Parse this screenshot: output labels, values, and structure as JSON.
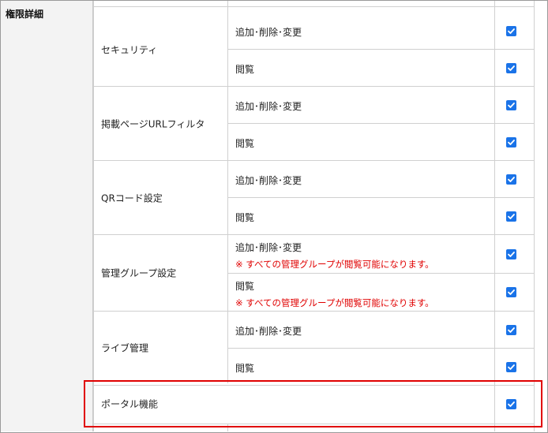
{
  "section": {
    "title": "権限詳細"
  },
  "categories": [
    {
      "name": "セキュリティ",
      "rows": [
        {
          "label": "追加･削除･変更",
          "note": ""
        },
        {
          "label": "閲覧",
          "note": ""
        }
      ]
    },
    {
      "name": "掲載ページURLフィルタ",
      "rows": [
        {
          "label": "追加･削除･変更",
          "note": ""
        },
        {
          "label": "閲覧",
          "note": ""
        }
      ]
    },
    {
      "name": "QRコード設定",
      "rows": [
        {
          "label": "追加･削除･変更",
          "note": ""
        },
        {
          "label": "閲覧",
          "note": ""
        }
      ]
    },
    {
      "name": "管理グループ設定",
      "rows": [
        {
          "label": "追加･削除･変更",
          "note": "※ すべての管理グループが閲覧可能になります。"
        },
        {
          "label": "閲覧",
          "note": "※ すべての管理グループが閲覧可能になります。"
        }
      ]
    },
    {
      "name": "ライブ管理",
      "rows": [
        {
          "label": "追加･削除･変更",
          "note": ""
        },
        {
          "label": "閲覧",
          "note": ""
        }
      ]
    },
    {
      "name": "ポータル機能",
      "rows": []
    }
  ],
  "checkbox_state": "checked",
  "colors": {
    "checkbox": "#1a73e8",
    "note": "#e00000",
    "highlight": "#e00000",
    "label_bg": "#f3f3f3"
  }
}
